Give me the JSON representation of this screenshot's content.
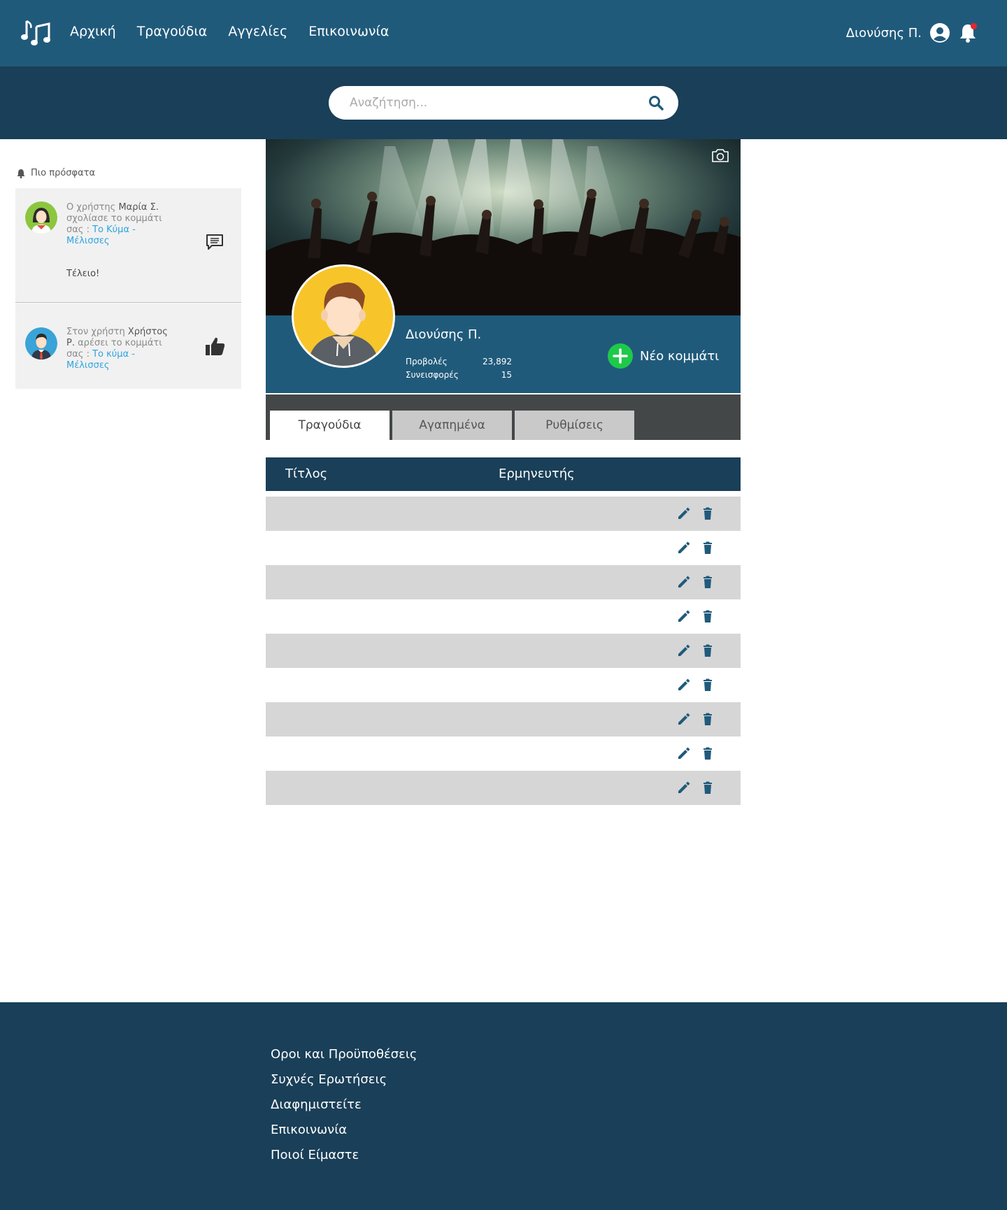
{
  "nav": {
    "links": [
      "Αρχική",
      "Τραγούδια",
      "Αγγελίες",
      "Επικοινωνία"
    ],
    "user_name": "Διονύσης Π."
  },
  "search": {
    "placeholder": "Αναζήτηση..."
  },
  "sidebar": {
    "title": "Πιο πρόσφατα",
    "items": [
      {
        "prefix": "Ο χρήστης ",
        "user": "Μαρία Σ.",
        "action": " σχολίασε το κομμάτι σας : ",
        "song": "Το Κύμα - Μέλισσες",
        "comment": "Τέλειο!",
        "icon": "comment-icon"
      },
      {
        "prefix": "Στον χρήστη ",
        "user": "Χρήστος Ρ.",
        "action": " αρέσει το κομμάτι σας : ",
        "song": "Το κύμα - Μέλισσες",
        "icon": "thumbs-up-icon"
      }
    ]
  },
  "profile": {
    "name": "Διονύσης Π.",
    "stats": [
      {
        "label": "Προβολές",
        "value": "23,892"
      },
      {
        "label": "Συνεισφορές",
        "value": "15"
      }
    ],
    "new_song_label": "Νέο κομμάτι"
  },
  "tabs": [
    "Τραγούδια",
    "Αγαπημένα",
    "Ρυθμίσεις"
  ],
  "active_tab": "Τραγούδια",
  "table": {
    "headers": [
      "Τίτλος",
      "Ερμηνευτής"
    ],
    "row_count": 9
  },
  "footer": {
    "links": [
      "Οροι και Προϋποθέσεις",
      "Συχνές Ερωτήσεις",
      "Διαφημιστείτε",
      "Επικοινωνία",
      "Ποιοί Είμαστε"
    ]
  },
  "colors": {
    "nav": "#205a7b",
    "dark": "#1a3f58",
    "accent_green": "#1ec94a",
    "link_blue": "#2ea3e0"
  }
}
